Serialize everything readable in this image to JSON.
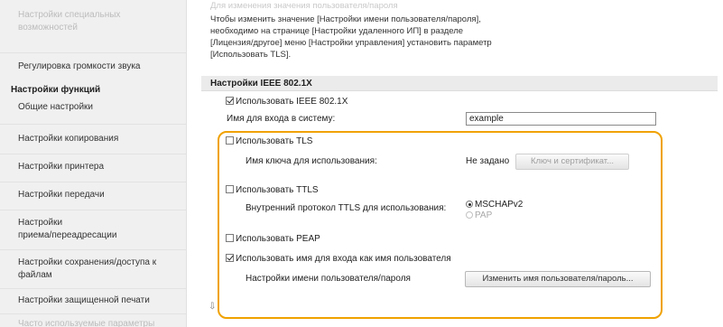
{
  "sidebar": {
    "items_top": [
      {
        "label": "Настройки специальных",
        "dim": true
      },
      {
        "label": "возможностей",
        "dim": true
      },
      {
        "label": "Регулировка громкости звука",
        "dim": false
      }
    ],
    "heading": "Настройки функций",
    "items": [
      {
        "label": "Общие настройки"
      },
      {
        "label": "Настройки копирования"
      },
      {
        "label": "Настройки принтера"
      },
      {
        "label": "Настройки передачи"
      },
      {
        "label": "Настройки"
      },
      {
        "label": "приема/переадресации"
      },
      {
        "label": "Настройки сохранения/доступа к"
      },
      {
        "label": "файлам"
      },
      {
        "label": "Настройки защищенной печати"
      },
      {
        "label": "Часто используемые параметры"
      }
    ]
  },
  "note": {
    "line0": "Для изменения значения пользователя/пароля",
    "line1": "Чтобы изменить значение [Настройки имени пользователя/пароля],",
    "line2": "необходимо на странице [Настройки удаленного ИП] в разделе",
    "line3": "[Лицензия/другое] меню [Настройки управления] установить параметр",
    "line4": "[Использовать TLS]."
  },
  "section": {
    "title": "Настройки IEEE 802.1X"
  },
  "form": {
    "use_ieee_label": "Использовать IEEE 802.1X",
    "use_ieee_checked": true,
    "login_name_label": "Имя для входа в систему:",
    "login_name_value": "example",
    "use_tls_label": "Использовать TLS",
    "use_tls_checked": false,
    "key_name_label": "Имя ключа для использования:",
    "key_name_value": "Не задано",
    "key_cert_button": "Ключ и сертификат...",
    "use_ttls_label": "Использовать TTLS",
    "use_ttls_checked": false,
    "ttls_protocol_label": "Внутренний протокол TTLS для использования:",
    "ttls_options": [
      "MSCHAPv2",
      "PAP"
    ],
    "ttls_selected": "MSCHAPv2",
    "use_peap_label": "Использовать PEAP",
    "use_peap_checked": false,
    "use_login_as_user_label": "Использовать имя для входа как имя пользователя",
    "use_login_as_user_checked": true,
    "user_pass_settings_label": "Настройки имени пользователя/пароля",
    "change_user_button": "Изменить имя пользователя/пароль..."
  },
  "footer": {
    "arrow_glyph": "⇩"
  },
  "colors": {
    "highlight": "#f0a200",
    "sidebar_bg": "#f0f0f0",
    "section_header_bg": "#ebebeb"
  }
}
